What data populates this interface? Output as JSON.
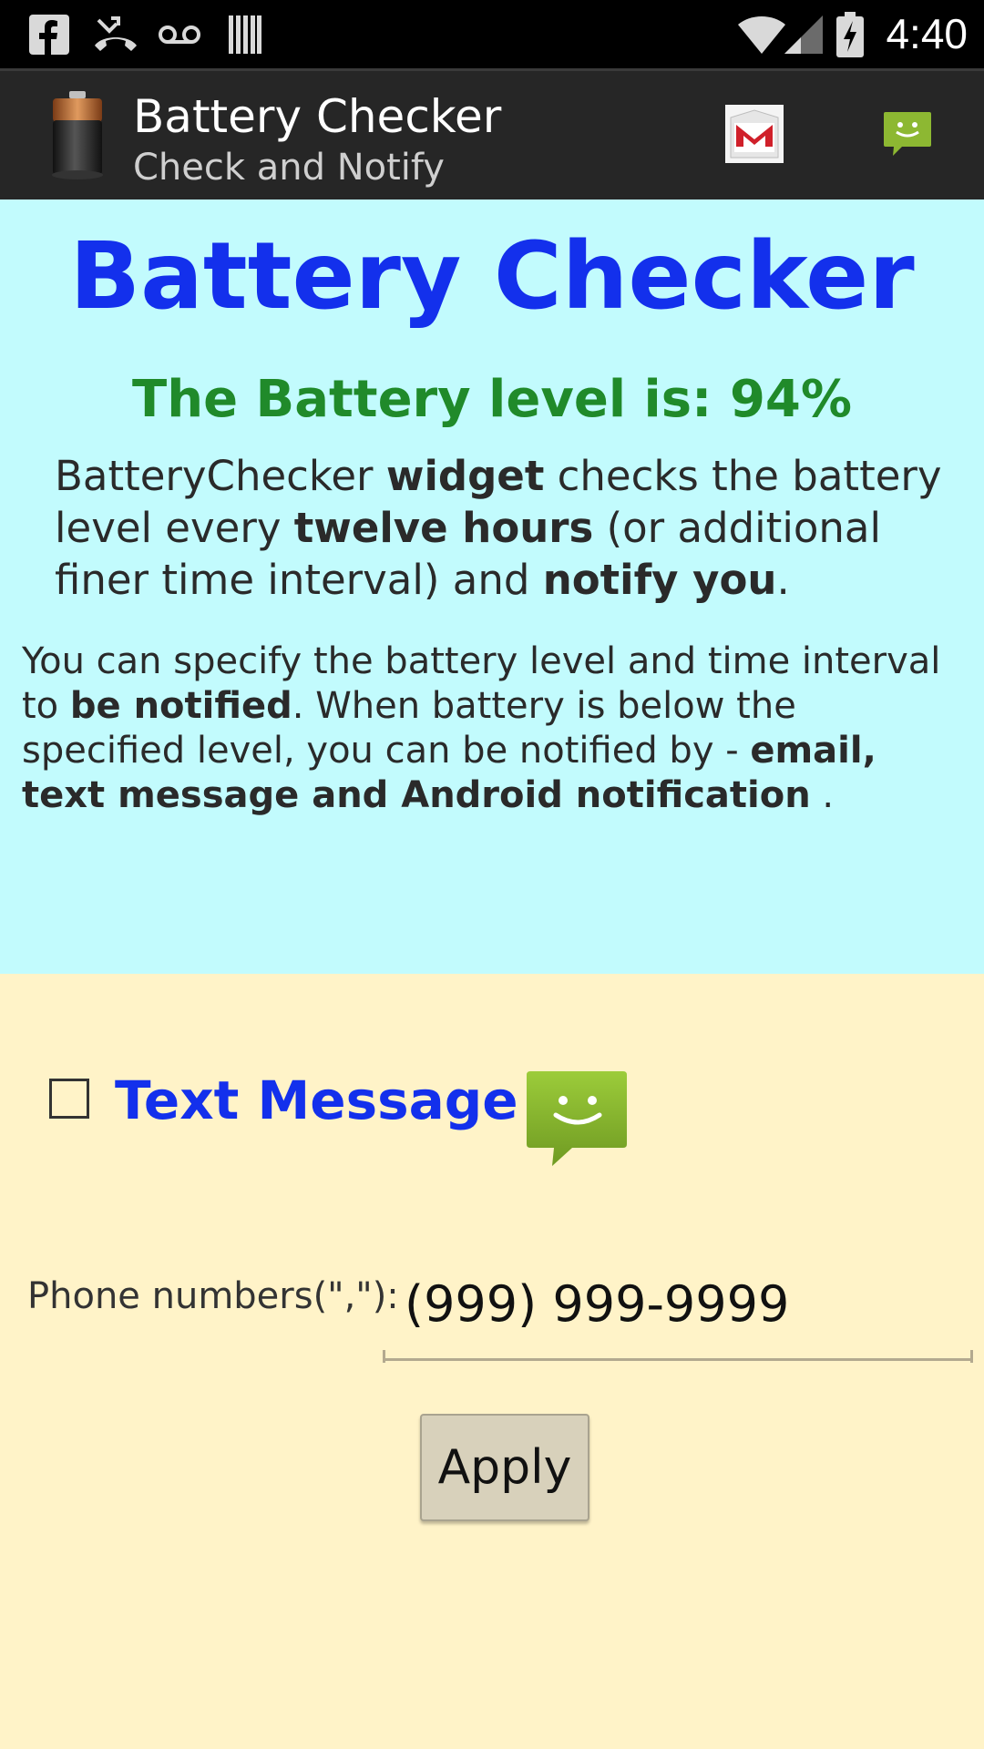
{
  "status_bar": {
    "time": "4:40",
    "icons": [
      "facebook-icon",
      "missed-call-icon",
      "voicemail-icon",
      "barcode-icon",
      "wifi-icon",
      "signal-icon",
      "battery-charging-icon"
    ]
  },
  "action_bar": {
    "title": "Battery Checker",
    "subtitle": "Check and Notify",
    "app_icon": "battery-icon",
    "actions": [
      "gmail-icon",
      "sms-icon"
    ]
  },
  "info": {
    "headline": "Battery Checker",
    "level_text": "The Battery level is: 94%",
    "battery_level_percent": 94,
    "desc1": {
      "p1": "BatteryChecker ",
      "b1": "widget",
      "p2": " checks the battery level every  ",
      "b2": "twelve hours",
      "p3": " (or additional finer time interval) and ",
      "b3": "notify you",
      "p4": "."
    },
    "desc2": {
      "p1": " You can specify the battery level and time interval to ",
      "b1": "be notified",
      "p2": ". When battery is below the specified level, you can be notified by - ",
      "b2": "email, text message and Android notification",
      "p3": " ."
    }
  },
  "form": {
    "checkbox_label": "Text Message",
    "checkbox_checked": false,
    "phone_label": "Phone numbers(\",\"):",
    "phone_value": "(999) 999-9999",
    "apply_label": "Apply"
  },
  "colors": {
    "status_bar_bg": "#000000",
    "action_bar_bg": "#262626",
    "info_bg": "#C2FBFD",
    "form_bg": "#FFF3C8",
    "headline": "#1330EC",
    "level": "#208A2A",
    "button_bg": "#D8D1BB",
    "sms_green": "#8DB832"
  }
}
